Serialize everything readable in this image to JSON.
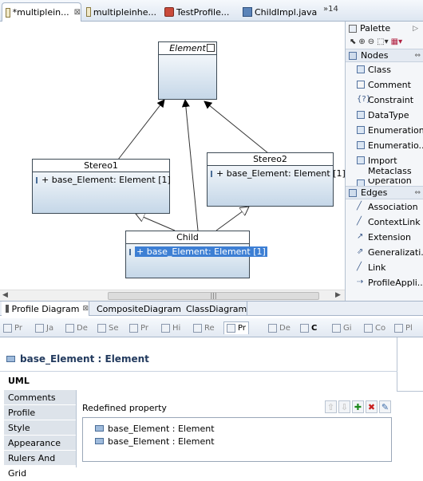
{
  "editor_tabs": [
    {
      "label": "*multiplein...",
      "active": true,
      "icon": "diagram-file-icon",
      "closable": true
    },
    {
      "label": "multipleinhe...",
      "active": false,
      "icon": "diagram-file-icon"
    },
    {
      "label": "TestProfile...",
      "active": false,
      "icon": "java-class-icon"
    },
    {
      "label": "ChildImpl.java",
      "active": false,
      "icon": "java-file-icon"
    }
  ],
  "tabs_overflow": "»14",
  "diagram": {
    "element": {
      "name": "Element"
    },
    "stereo1": {
      "name": "Stereo1",
      "attr": "+ base_Element: Element [1]"
    },
    "stereo2": {
      "name": "Stereo2",
      "attr": "+ base_Element: Element [1]"
    },
    "child": {
      "name": "Child",
      "attr": "+ base_Element: Element [1]"
    }
  },
  "palette": {
    "title": "Palette",
    "nodes_header": "Nodes",
    "nodes": [
      "Class",
      "Comment",
      "Constraint",
      "DataType",
      "Enumeration",
      "Enumeratio...",
      "Import Metaclass",
      "Operation"
    ],
    "edges_header": "Edges",
    "edges": [
      "Association",
      "ContextLink",
      "Extension",
      "Generalizati...",
      "Link",
      "ProfileAppli..."
    ]
  },
  "editor_bottom_tabs": [
    {
      "label": "Profile Diagram",
      "active": true
    },
    {
      "label": "CompositeDiagram",
      "active": false
    },
    {
      "label": "ClassDiagram",
      "active": false
    }
  ],
  "view_tabs": [
    "Pr",
    "Ja",
    "De",
    "Se",
    "Pr",
    "Hi",
    "Re",
    "Pr",
    "De",
    "C",
    "Gi",
    "Co",
    "Pl"
  ],
  "properties": {
    "title": "base_Element : Element",
    "side_tabs": [
      "UML",
      "Comments",
      "Profile",
      "Style",
      "Appearance",
      "Rulers And Grid"
    ],
    "active_tab": "UML",
    "field_label": "Redefined property",
    "list_items": [
      "base_Element : Element",
      "base_Element : Element"
    ]
  },
  "colors": {
    "selection": "#3d7fd4",
    "class_fill_bottom": "#c5d7e8",
    "title_text": "#223a5e"
  }
}
